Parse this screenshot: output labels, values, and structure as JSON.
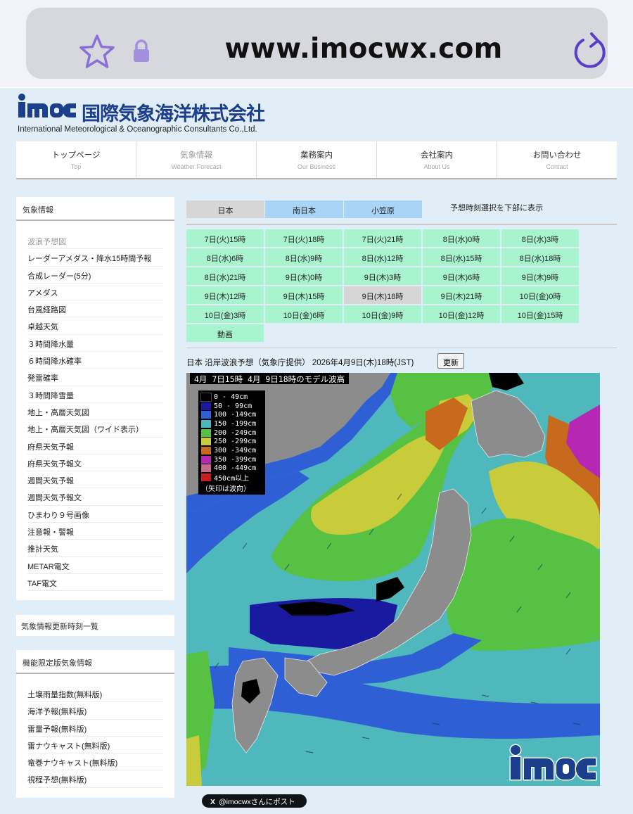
{
  "browser": {
    "url": "www.imocwx.com",
    "icons": [
      "star-icon",
      "lock-icon",
      "reload-icon"
    ]
  },
  "site": {
    "logo_text": "imoc",
    "company_jp": "国際気象海洋株式会社",
    "company_en": "International Meteorological & Oceanographic Consultants Co.,Ltd.",
    "nav": [
      {
        "jp": "トップページ",
        "en": "Top"
      },
      {
        "jp": "気象情報",
        "en": "Weather Forecast"
      },
      {
        "jp": "業務案内",
        "en": "Our Business"
      },
      {
        "jp": "会社案内",
        "en": "About Us"
      },
      {
        "jp": "お問い合わせ",
        "en": "Contact"
      }
    ]
  },
  "sidebar": {
    "weather_head": "気象情報",
    "weather_items": [
      "波浪予想図",
      "レーダーアメダス・降水15時間予報",
      "合成レーダー(5分)",
      "アメダス",
      "台風経路図",
      "卓越天気",
      "３時間降水量",
      "６時間降水確率",
      "発雷確率",
      "３時間降雪量",
      "地上・高層天気図",
      "地上・高層天気図（ワイド表示）",
      "府県天気予報",
      "府県天気予報文",
      "週間天気予報",
      "週間天気予報文",
      "ひまわり９号画像",
      "注意報・警報",
      "推計天気",
      "METAR電文",
      "TAF電文"
    ],
    "update_list": "気象情報更新時刻一覧",
    "limited_head": "機能限定版気象情報",
    "limited_items": [
      "土壌雨量指数(無料版)",
      "海洋予報(無料版)",
      "雷量予報(無料版)",
      "雷ナウキャスト(無料版)",
      "竜巻ナウキャスト(無料版)",
      "視程予想(無料版)"
    ]
  },
  "main": {
    "region_tabs": [
      "日本",
      "南日本",
      "小笠原"
    ],
    "time_hint": "予想時刻選択を下部に表示",
    "times": [
      "7日(火)15時",
      "7日(火)18時",
      "7日(火)21時",
      "8日(水)0時",
      "8日(水)3時",
      "8日(水)6時",
      "8日(水)9時",
      "8日(水)12時",
      "8日(水)15時",
      "8日(水)18時",
      "8日(水)21時",
      "9日(木)0時",
      "9日(木)3時",
      "9日(木)6時",
      "9日(木)9時",
      "9日(木)12時",
      "9日(木)15時",
      "9日(木)18時",
      "9日(木)21時",
      "10日(金)0時",
      "10日(金)3時",
      "10日(金)6時",
      "10日(金)9時",
      "10日(金)12時",
      "10日(金)15時",
      "動画"
    ],
    "selected_time": "9日(木)18時",
    "forecast_title": "日本 沿岸波浪予想（気象庁提供） 2026年4月9日(木)18時(JST)",
    "update_button": "更新",
    "map": {
      "header": "4月 7日15時   4月 9日18時のモデル波高",
      "legend": [
        {
          "label": "  0 - 49cm",
          "color": "#000000"
        },
        {
          "label": " 50 - 99cm",
          "color": "#1a1aa0"
        },
        {
          "label": "100 -149cm",
          "color": "#2e5fd6"
        },
        {
          "label": "150 -199cm",
          "color": "#4ab8bd"
        },
        {
          "label": "200 -249cm",
          "color": "#56c143"
        },
        {
          "label": "250 -299cm",
          "color": "#c8cc3a"
        },
        {
          "label": "300 -349cm",
          "color": "#c86a1e"
        },
        {
          "label": "350 -399cm",
          "color": "#b628b4"
        },
        {
          "label": "400 -449cm",
          "color": "#c86a8a"
        },
        {
          "label": " 450cm以上",
          "color": "#c81e1e"
        }
      ],
      "legend_note": "（矢印は波向）",
      "watermark": "imoc"
    },
    "post_button": "@imocwxさんにポスト",
    "post_x": "X"
  }
}
